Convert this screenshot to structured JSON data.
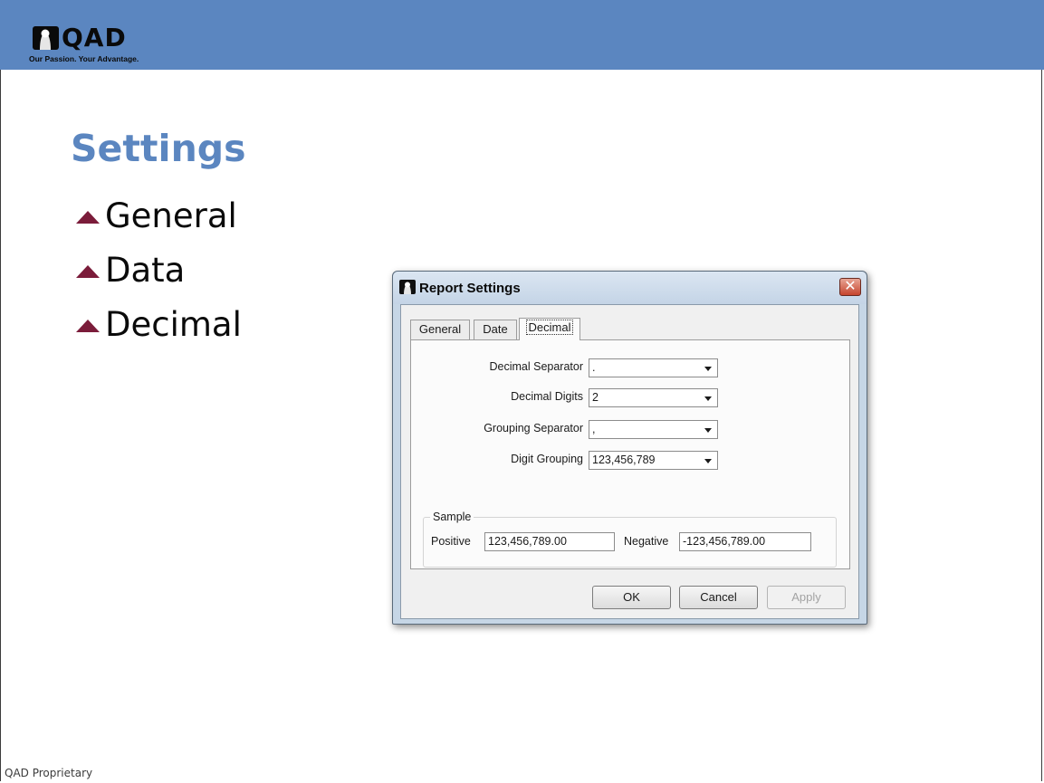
{
  "brand": {
    "name": "QAD",
    "tagline": "Our Passion. Your Advantage.",
    "header_color": "#5b86c0",
    "bullet_color": "#7b1c3a"
  },
  "slide": {
    "title": "Settings",
    "bullets": [
      "General",
      "Data",
      "Decimal"
    ],
    "footer": "QAD Proprietary"
  },
  "dialog": {
    "title": "Report Settings",
    "close_icon": "close-icon",
    "tabs": [
      "General",
      "Date",
      "Decimal"
    ],
    "active_tab": "Decimal",
    "fields": [
      {
        "label": "Decimal Separator",
        "value": "."
      },
      {
        "label": "Decimal Digits",
        "value": "2"
      },
      {
        "label": "Grouping Separator",
        "value": ","
      },
      {
        "label": "Digit Grouping",
        "value": "123,456,789"
      }
    ],
    "sample": {
      "legend": "Sample",
      "positive_label": "Positive",
      "positive_value": "123,456,789.00",
      "negative_label": "Negative",
      "negative_value": "-123,456,789.00"
    },
    "buttons": {
      "ok": "OK",
      "cancel": "Cancel",
      "apply": "Apply"
    }
  }
}
